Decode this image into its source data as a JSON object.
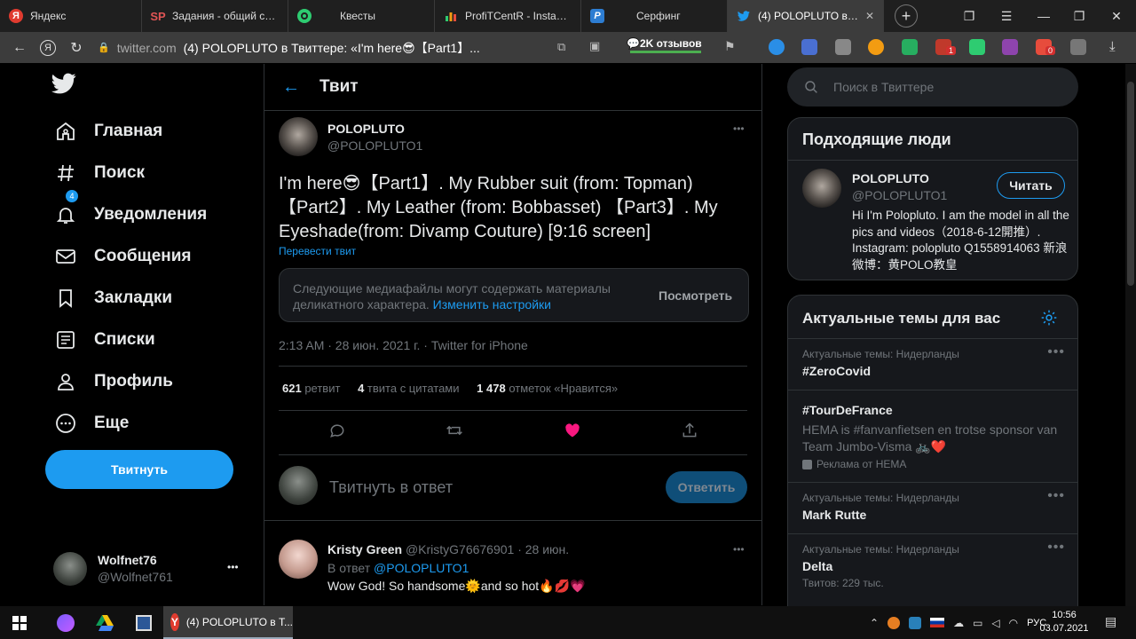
{
  "browser": {
    "tabs": [
      {
        "label": "Яндекс",
        "icon": "yandex-icon",
        "color": "#e03b2f"
      },
      {
        "label": "Задания - общий спис",
        "icon": "sp-icon",
        "color": "#c0392b"
      },
      {
        "label": "Квесты",
        "icon": "quest-icon",
        "color": "#2ecc71"
      },
      {
        "label": "ProfiTCentR - Instagram",
        "icon": "chart-icon",
        "color": "#f39c12"
      },
      {
        "label": "Серфинг",
        "icon": "p-icon",
        "color": "#2d7dd2"
      },
      {
        "label": "(4) POLOPLUTO в Тв",
        "icon": "twitter-icon",
        "color": "#1d9bf0"
      }
    ],
    "url_domain": "twitter.com",
    "url_title": "(4) POLOPLUTO в Твиттере: «I'm here😎【Part1】...",
    "reviews": "💬2K отзывов",
    "ext_badge_1": "1",
    "ext_badge_2": "0"
  },
  "nav": {
    "items": [
      {
        "label": "Главная",
        "icon": "home-icon"
      },
      {
        "label": "Поиск",
        "icon": "hashtag-icon"
      },
      {
        "label": "Уведомления",
        "icon": "bell-icon",
        "badge": "4"
      },
      {
        "label": "Сообщения",
        "icon": "mail-icon"
      },
      {
        "label": "Закладки",
        "icon": "bookmark-icon"
      },
      {
        "label": "Списки",
        "icon": "list-icon"
      },
      {
        "label": "Профиль",
        "icon": "profile-icon"
      },
      {
        "label": "Еще",
        "icon": "more-icon"
      }
    ],
    "tweet_button": "Твитнуть",
    "me_name": "Wolfnet76",
    "me_handle": "@Wolfnet761",
    "me_more": "•••"
  },
  "header": {
    "title": "Твит"
  },
  "tweet": {
    "author_name": "POLOPLUTO",
    "author_handle": "@POLOPLUTO1",
    "more": "•••",
    "text": "I'm here😎【Part1】. My Rubber suit (from: Topman)【Part2】. My Leather (from: Bobbasset) 【Part3】. My Eyeshade(from: Divamp Couture) [9:16 screen]",
    "translate": "Перевести твит",
    "sensitive_text": "Следующие медиафайлы могут содержать материалы деликатного характера.",
    "sensitive_link": "Изменить настройки",
    "view_button": "Посмотреть",
    "meta": "2:13 AM · 28 июн. 2021 г. · Twitter for iPhone",
    "retweets_count": "621",
    "retweets_label": "ретвит",
    "quotes_count": "4",
    "quotes_label": "твита с цитатами",
    "likes_count": "1 478",
    "likes_label": "отметок «Нравится»"
  },
  "reply_box": {
    "placeholder": "Твитнуть в ответ",
    "button": "Ответить"
  },
  "reply": {
    "name": "Kristy Green",
    "handle": "@KristyG76676901 · 28 июн.",
    "reply_to_label": "В ответ",
    "reply_to_handle": "@POLOPLUTO1",
    "text": "Wow God! So handsome🌞and so hot🔥💋💗",
    "more": "•••"
  },
  "search": {
    "placeholder": "Поиск в Твиттере"
  },
  "who_to_follow": {
    "title": "Подходящие люди",
    "name": "POLOPLUTO",
    "handle": "@POLOPLUTO1",
    "button": "Читать",
    "bio": "Hi I'm Polopluto. I am the model in all the pics and videos（2018-6-12開推）. Instagram: polopluto Q1558914063 新浪微博：黄POLO教皇"
  },
  "trends": {
    "title": "Актуальные темы для вас",
    "items": [
      {
        "context": "Актуальные темы: Нидерланды",
        "name": "#ZeroCovid",
        "extra": ""
      },
      {
        "context": "",
        "name": "#TourDeFrance",
        "desc": "HEMA is #fanvanfietsen en trotse sponsor van Team Jumbo-Visma 🚲❤️",
        "extra": "Реклама от HEMA"
      },
      {
        "context": "Актуальные темы: Нидерланды",
        "name": "Mark Rutte",
        "extra": ""
      },
      {
        "context": "Актуальные темы: Нидерланды",
        "name": "Delta",
        "extra": "Твитов: 229 тыс."
      }
    ]
  },
  "taskbar": {
    "app_label": "(4) POLOPLUTO в Т...",
    "lang": "РУС",
    "time": "10:56",
    "date": "03.07.2021"
  },
  "colors": {
    "accent": "#1d9bf0",
    "like": "#f91880",
    "bg": "#000000",
    "card": "#16181c",
    "border": "#2f3336"
  }
}
